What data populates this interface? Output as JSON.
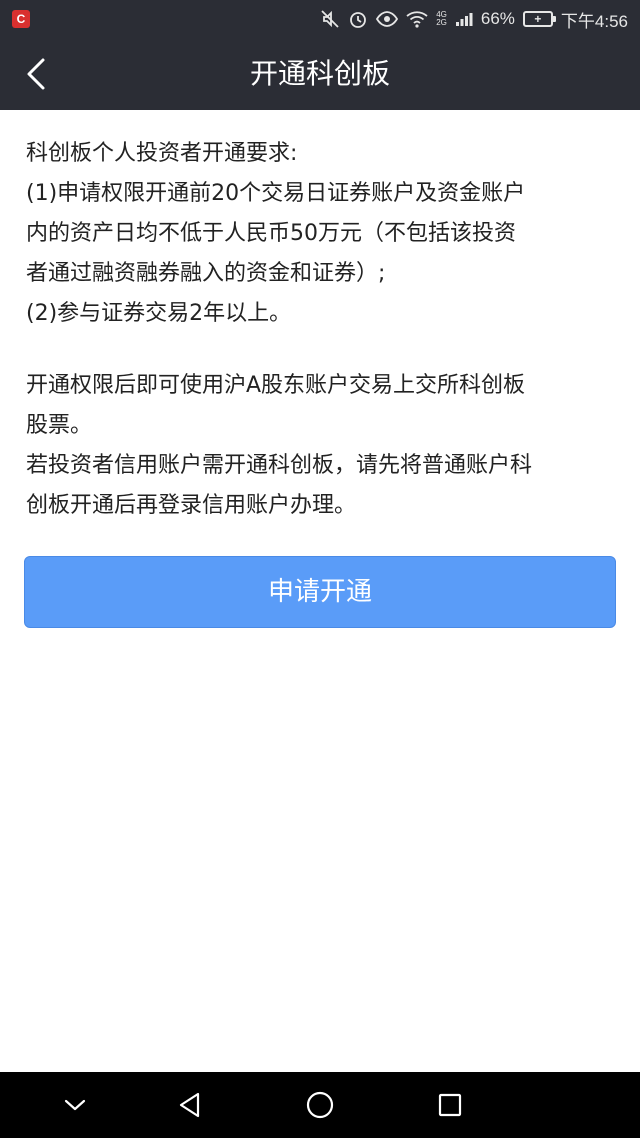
{
  "status_bar": {
    "app_badge": "C",
    "network_top": "4G",
    "network_bottom": "2G",
    "battery_percent": "66%",
    "time": "下午4:56"
  },
  "nav": {
    "title": "开通科创板"
  },
  "content": {
    "heading": "科创板个人投资者开通要求:",
    "req1_line1": "(1)申请权限开通前20个交易日证券账户及资金账户",
    "req1_line2": "内的资产日均不低于人民币50万元（不包括该投资",
    "req1_line3": "者通过融资融券融入的资金和证券）;",
    "req2": "(2)参与证券交易2年以上。",
    "note1_line1": "开通权限后即可使用沪A股东账户交易上交所科创板",
    "note1_line2": "股票。",
    "note2_line1": "若投资者信用账户需开通科创板，请先将普通账户科",
    "note2_line2": "创板开通后再登录信用账户办理。"
  },
  "actions": {
    "apply_label": "申请开通"
  },
  "colors": {
    "header_bg": "#2b2d35",
    "button_bg": "#5a9cf8",
    "sys_nav_bg": "#000000"
  }
}
